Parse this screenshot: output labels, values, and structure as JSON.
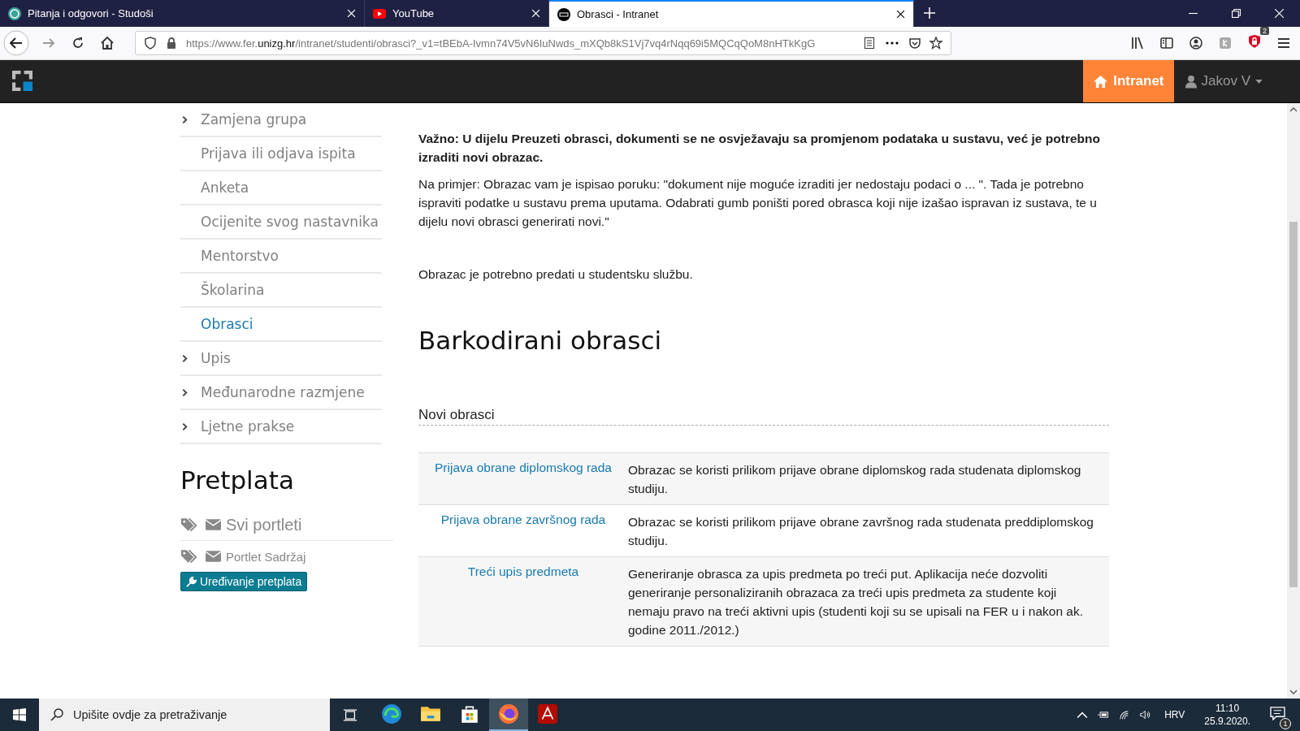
{
  "browser": {
    "tabs": [
      {
        "title": "Pitanja i odgovori - Studoši",
        "kind": "studosi",
        "selected": false
      },
      {
        "title": "YouTube",
        "kind": "youtube",
        "selected": false
      },
      {
        "title": "Obrasci - Intranet",
        "kind": "fer",
        "selected": true
      }
    ],
    "url": {
      "prefix": "https://www.fer.",
      "domain": "unizg.hr",
      "path": "/intranet/studenti/obrasci?_v1=tBEbA-Ivmn74V5vN6IuNwds_mXQb8kS1Vj7vq4rNqq69i5MQCqQoM8nHTkKgG"
    },
    "extension_badge": "2"
  },
  "navbar": {
    "intranet_button": "Intranet",
    "user": "Jakov V"
  },
  "sidebar": {
    "items": [
      {
        "label": "Zamjena grupa",
        "expandable": true,
        "selected": false
      },
      {
        "label": "Prijava ili odjava ispita",
        "expandable": false,
        "selected": false
      },
      {
        "label": "Anketa",
        "expandable": false,
        "selected": false
      },
      {
        "label": "Ocijenite svog nastavnika",
        "expandable": false,
        "selected": false
      },
      {
        "label": "Mentorstvo",
        "expandable": false,
        "selected": false
      },
      {
        "label": "Školarina",
        "expandable": false,
        "selected": false
      },
      {
        "label": "Obrasci",
        "expandable": false,
        "selected": true
      },
      {
        "label": "Upis",
        "expandable": true,
        "selected": false
      },
      {
        "label": "Međunarodne razmjene",
        "expandable": true,
        "selected": false
      },
      {
        "label": "Ljetne prakse",
        "expandable": true,
        "selected": false
      }
    ]
  },
  "subscription": {
    "title": "Pretplata",
    "items": [
      {
        "label": "Svi portleti",
        "kind": "all"
      },
      {
        "label": "Portlet Sadržaj",
        "kind": "single"
      }
    ],
    "edit_button": "Uređivanje pretplata"
  },
  "main": {
    "notice": "Važno: U dijelu Preuzeti obrasci, dokumenti se ne osvježavaju sa promjenom podataka u sustavu, već je potrebno izraditi novi obrazac.",
    "example": "Na primjer: Obrazac vam je ispisao poruku: \"dokument nije moguće izraditi jer nedostaju podaci o ... \". Tada je potrebno ispraviti podatke u sustavu prema uputama. Odabrati gumb poništi pored obrasca koji nije izašao ispravan iz sustava, te u dijelu novi obrasci generirati novi.\"",
    "submit_note": "Obrazac je potrebno predati u studentsku službu.",
    "heading": "Barkodirani obrasci",
    "subheading": "Novi obrasci",
    "forms": [
      {
        "link": "Prijava obrane diplomskog rada",
        "description": "Obrazac se koristi prilikom prijave obrane diplomskog rada studenata diplomskog studiju."
      },
      {
        "link": "Prijava obrane završnog rada",
        "description": "Obrazac se koristi prilikom prijave obrane završnog rada studenata preddiplomskog studiju."
      },
      {
        "link": "Treći upis predmeta",
        "description": "Generiranje obrasca za upis predmeta po treći put. Aplikacija neće dozvoliti generiranje personaliziranih obrazaca za treći upis predmeta za studente koji nemaju pravo na treći aktivni upis (studenti koji su se upisali na FER u i nakon ak. godine 2011./2012.)"
      }
    ]
  },
  "taskbar": {
    "search_placeholder": "Upišite ovdje za pretraživanje",
    "apps": [
      {
        "kind": "edge",
        "selected": false
      },
      {
        "kind": "explorer",
        "selected": false
      },
      {
        "kind": "store",
        "selected": false
      },
      {
        "kind": "firefox",
        "selected": true
      },
      {
        "kind": "acrobat",
        "selected": false
      }
    ],
    "language": "HRV",
    "time": "11:10",
    "date": "25.9.2020.",
    "notifications": "1"
  }
}
